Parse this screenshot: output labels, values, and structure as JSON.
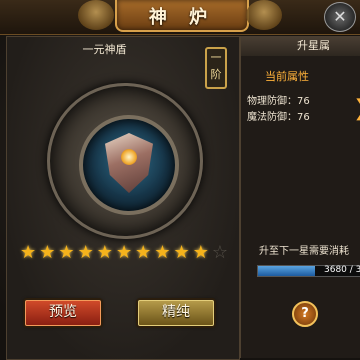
{
  "window": {
    "title": "神 炉",
    "close_glyph": "✕"
  },
  "item": {
    "name": "一元神盾",
    "tier": "一\n阶"
  },
  "stars": {
    "filled": 10,
    "total": 11
  },
  "buttons": {
    "preview": "预览",
    "refine": "精纯"
  },
  "panel": {
    "header": "升星属",
    "attr_title": "当前属性",
    "attributes": [
      "物理防御：76",
      "魔法防御：76"
    ],
    "upgrade_label": "升至下一星需要消耗",
    "progress": {
      "text": "3680 / 3",
      "fraction": 0.55
    },
    "help_glyph": "?"
  },
  "colors": {
    "accent": "#ffb23a",
    "star": "#f5b31c",
    "progress": "#3b82c8"
  }
}
